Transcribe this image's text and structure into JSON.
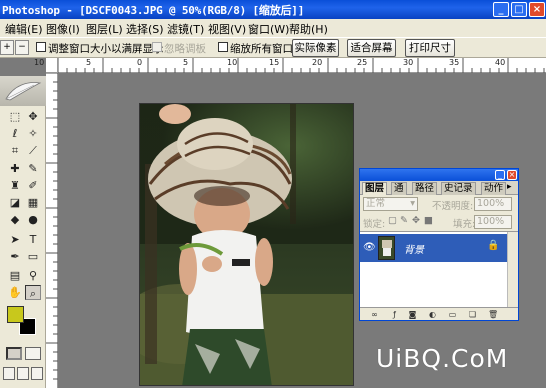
{
  "window": {
    "title": "Photoshop - [DSCF0043.JPG @ 50%(RGB/8) [缩放后]]"
  },
  "menu": [
    "编辑(E)",
    "图像(I)",
    "图层(L)",
    "选择(S)",
    "滤镜(T)",
    "视图(V)",
    "窗口(W)",
    "帮助(H)"
  ],
  "options": {
    "resize_window_label": "调整窗口大小以满屏显示",
    "ignore_palettes_label": "忽略调板",
    "zoom_all_windows_label": "缩放所有窗口",
    "actual_pixels_button": "实际像素",
    "fit_screen_button": "适合屏幕",
    "print_size_button": "打印尺寸"
  },
  "ruler": {
    "labels": [
      "10",
      "5",
      "0",
      "5",
      "10",
      "15",
      "20",
      "25",
      "30",
      "35",
      "40"
    ]
  },
  "layers_panel": {
    "tabs": [
      "图层",
      "通",
      "路径",
      "史记录",
      "动作"
    ],
    "blend_mode": "正常",
    "opacity_label": "不透明度:",
    "opacity_value": "100%",
    "lock_label": "锁定:",
    "fill_label": "填充:",
    "fill_value": "100%",
    "layers": [
      {
        "name": "背景",
        "visible": true,
        "locked": true
      }
    ]
  },
  "colors": {
    "foreground": "#c8c81c",
    "background": "#000000",
    "accent": "#0a4fd8"
  },
  "watermark": "UiBQ.CoM"
}
